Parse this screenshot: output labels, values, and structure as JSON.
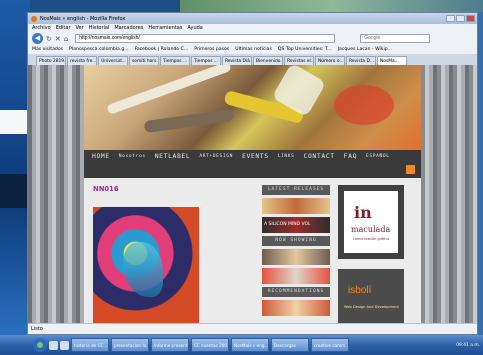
{
  "window": {
    "title": "NosMais » english - Mozilla Firefox",
    "menu": [
      "Archivo",
      "Editar",
      "Ver",
      "Historial",
      "Marcadores",
      "Herramientas",
      "Ayuda"
    ],
    "url": "http://nosmais.com/english/",
    "search_placeholder": "Google",
    "bookmarks": [
      "Más visitados",
      "Planospesca.colombia.g...",
      "Facebook | Rolando C...",
      "Primeros pasos",
      "Últimas noticias",
      "QS Top Universities: T...",
      "Jacques Lacan - Wikip..."
    ],
    "tabs": [
      "Photo 2819...",
      "revista fre...",
      "Universid...",
      "semiti hors...",
      "Tiempos ...",
      "Tiempos ...",
      "Revista Diá...",
      "Bienvenido...",
      "Revistas el...",
      "Número o...",
      "Revista D...",
      "NosMa..."
    ],
    "active_tab_index": 11,
    "status": "Listo"
  },
  "site": {
    "nav": [
      "HOME",
      "Nosotros",
      "NETLABEL",
      "ART+DESIGN",
      "EVENTS",
      "LINKS",
      "CONTACT",
      "FAQ",
      "ESPAÑOL"
    ],
    "post_title": "NN016",
    "sidebar": {
      "latest_releases": "LATEST RELEASES",
      "release_caption": "A SILICON MIND VOL",
      "now_showing": "NOW SHOWING",
      "recommendations": "RECOMMENDATIONS"
    },
    "ads": {
      "ad1_logo_big": "in",
      "ad1_logo_word": "maculada",
      "ad1_logo_sub": "comunicación gráfica",
      "ad2_brand": "isbolí",
      "ad2_sub": "Web Design And Development"
    }
  },
  "taskbar": {
    "buttons": [
      "historia de CC ...",
      "presentacion la...",
      "Informe present...",
      "CC cuentas 200...",
      "NosMais » eng...",
      "Descargas",
      "creative comm..."
    ],
    "clock": "09:41 a.m."
  }
}
